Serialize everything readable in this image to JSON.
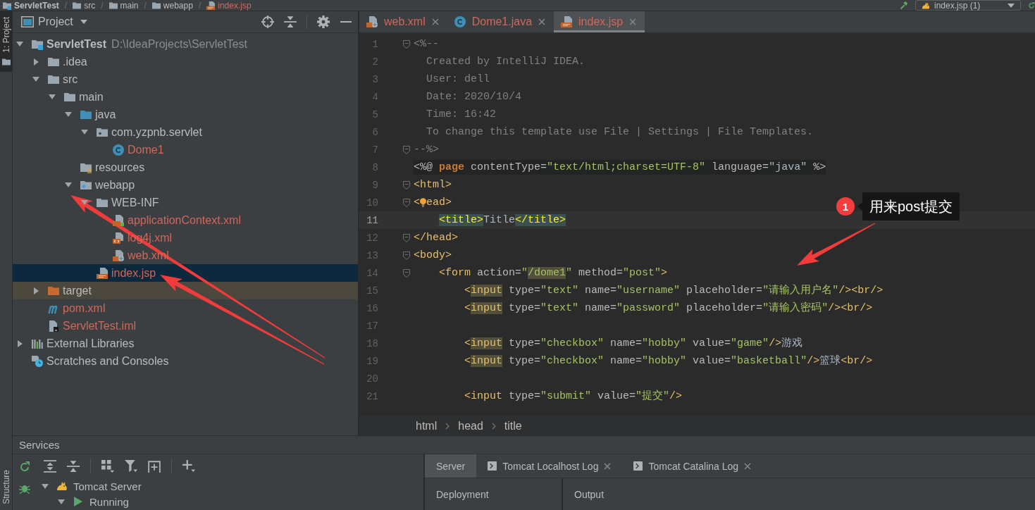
{
  "navbar": {
    "breadcrumbs": [
      {
        "kind": "module",
        "label": "ServletTest"
      },
      {
        "kind": "folder",
        "separator": "/",
        "label": "src"
      },
      {
        "kind": "folder",
        "separator": "/",
        "label": "main"
      },
      {
        "kind": "folder",
        "separator": "/",
        "label": "webapp"
      },
      {
        "kind": "jsp",
        "separator": "/",
        "label": "index.jsp"
      }
    ],
    "run_config": "index.jsp (1)"
  },
  "left_stripe": {
    "top": [
      {
        "label": "1: Project",
        "selected": true
      }
    ],
    "bottom": [
      {
        "label": "Structure",
        "selected": false
      }
    ]
  },
  "project_panel": {
    "title": "Project",
    "tree": [
      {
        "label": "ServletTest",
        "path": "D:\\IdeaProjects\\ServletTest",
        "kind": "module",
        "color": "#bbbbbb",
        "expanded": true,
        "selected": false,
        "children": [
          {
            "label": ".idea",
            "kind": "folder",
            "color": "#bbbbbb",
            "expanded": false,
            "selected": false
          },
          {
            "label": "src",
            "kind": "folder",
            "color": "#bbbbbb",
            "expanded": true,
            "selected": false,
            "children": [
              {
                "label": "main",
                "kind": "folder",
                "color": "#bbbbbb",
                "expanded": true,
                "selected": false,
                "children": [
                  {
                    "label": "java",
                    "kind": "source-folder",
                    "color": "#bbbbbb",
                    "expanded": true,
                    "selected": false,
                    "children": [
                      {
                        "label": "com.yzpnb.servlet",
                        "kind": "package",
                        "color": "#bbbbbb",
                        "expanded": true,
                        "selected": false,
                        "children": [
                          {
                            "label": "Dome1",
                            "kind": "class",
                            "color": "#d1675a",
                            "selected": false
                          }
                        ]
                      }
                    ]
                  },
                  {
                    "label": "resources",
                    "kind": "resources-folder",
                    "color": "#bbbbbb",
                    "selected": false
                  },
                  {
                    "label": "webapp",
                    "kind": "web-folder",
                    "color": "#bbbbbb",
                    "expanded": true,
                    "selected": false,
                    "children": [
                      {
                        "label": "WEB-INF",
                        "kind": "folder",
                        "color": "#bbbbbb",
                        "expanded": true,
                        "selected": false,
                        "children": [
                          {
                            "label": "applicationContext.xml",
                            "kind": "spring-xml",
                            "color": "#d1675a",
                            "selected": false
                          },
                          {
                            "label": "log4j.xml",
                            "kind": "xml",
                            "color": "#d1675a",
                            "selected": false
                          },
                          {
                            "label": "web.xml",
                            "kind": "web-xml",
                            "color": "#d1675a",
                            "selected": false
                          }
                        ]
                      },
                      {
                        "label": "index.jsp",
                        "kind": "jsp",
                        "color": "#d1675a",
                        "selected": true
                      }
                    ]
                  }
                ]
              }
            ]
          },
          {
            "label": "target",
            "kind": "excluded-folder",
            "color": "#bbbbbb",
            "expanded": false,
            "selected": false
          },
          {
            "label": "pom.xml",
            "kind": "maven",
            "color": "#d1675a",
            "selected": false
          },
          {
            "label": "ServletTest.iml",
            "kind": "iml",
            "color": "#d1675a",
            "selected": false
          }
        ]
      },
      {
        "label": "External Libraries",
        "kind": "libraries",
        "color": "#bbbbbb",
        "expanded": false,
        "selected": false
      },
      {
        "label": "Scratches and Consoles",
        "kind": "scratches",
        "color": "#bbbbbb",
        "selected": false
      }
    ]
  },
  "editor": {
    "tabs": [
      {
        "label": "web.xml",
        "kind": "web-xml",
        "selected": false
      },
      {
        "label": "Dome1.java",
        "kind": "class",
        "selected": false
      },
      {
        "label": "index.jsp",
        "kind": "jsp",
        "selected": true
      }
    ],
    "lines": [
      {
        "number": "1",
        "kind": "comment",
        "fold": true,
        "current": false,
        "tokens": [
          {
            "kind": "comment",
            "text": "<%--"
          }
        ]
      },
      {
        "number": "2",
        "kind": "comment",
        "fold": false,
        "current": false,
        "tokens": [
          {
            "kind": "comment",
            "text": "  Created by IntelliJ IDEA."
          }
        ]
      },
      {
        "number": "3",
        "kind": "comment",
        "fold": false,
        "current": false,
        "tokens": [
          {
            "kind": "comment",
            "text": "  User: dell"
          }
        ]
      },
      {
        "number": "4",
        "kind": "comment",
        "fold": false,
        "current": false,
        "tokens": [
          {
            "kind": "comment",
            "text": "  Date: 2020/10/4"
          }
        ]
      },
      {
        "number": "5",
        "kind": "comment",
        "fold": false,
        "current": false,
        "tokens": [
          {
            "kind": "comment",
            "text": "  Time: 16:42"
          }
        ]
      },
      {
        "number": "6",
        "kind": "comment",
        "fold": false,
        "current": false,
        "tokens": [
          {
            "kind": "comment",
            "text": "  To change this template use File | Settings | File Templates."
          }
        ]
      },
      {
        "number": "7",
        "kind": "comment",
        "fold": true,
        "current": false,
        "tokens": [
          {
            "kind": "comment",
            "text": "--%>"
          }
        ]
      },
      {
        "number": "8",
        "kind": "directive",
        "fold": false,
        "current": false,
        "tokens": [
          {
            "kind": "directive",
            "text": "<%@ "
          },
          {
            "kind": "keyword",
            "text": "page"
          },
          {
            "kind": "attr",
            "text": " contentType="
          },
          {
            "kind": "value",
            "text": "\"text/html;charset=UTF-8\""
          },
          {
            "kind": "attr",
            "text": " language="
          },
          {
            "kind": "text",
            "text": "\"java\""
          },
          {
            "kind": "directive",
            "text": " %>"
          }
        ]
      },
      {
        "number": "9",
        "kind": "markup",
        "fold": true,
        "current": false,
        "tokens": [
          {
            "kind": "tag",
            "text": "<html>"
          }
        ]
      },
      {
        "number": "10",
        "kind": "markup",
        "fold": true,
        "current": false,
        "tokens": [
          {
            "kind": "tag",
            "text": "<"
          },
          {
            "kind": "bulb"
          },
          {
            "kind": "tag",
            "text": "ead>"
          }
        ]
      },
      {
        "number": "11",
        "kind": "markup",
        "fold": false,
        "current": true,
        "tokens": [
          {
            "kind": "tag-match",
            "text": "    <title>"
          },
          {
            "kind": "text",
            "text": "Title"
          },
          {
            "kind": "tag-match",
            "text": "</title>"
          }
        ]
      },
      {
        "number": "12",
        "kind": "markup",
        "fold": true,
        "current": false,
        "tokens": [
          {
            "kind": "tag",
            "text": "</head>"
          }
        ]
      },
      {
        "number": "13",
        "kind": "markup",
        "fold": true,
        "current": false,
        "tokens": [
          {
            "kind": "tag",
            "text": "<body>"
          }
        ]
      },
      {
        "number": "14",
        "kind": "markup",
        "fold": true,
        "current": false,
        "tokens": [
          {
            "kind": "tag",
            "text": "    <form"
          },
          {
            "kind": "attr",
            "text": " action="
          },
          {
            "kind": "value",
            "text": "\""
          },
          {
            "kind": "value-usage",
            "text": "/dome1"
          },
          {
            "kind": "value",
            "text": "\""
          },
          {
            "kind": "attr",
            "text": " method="
          },
          {
            "kind": "value",
            "text": "\"post\""
          },
          {
            "kind": "tag",
            "text": ">"
          }
        ]
      },
      {
        "number": "15",
        "kind": "markup",
        "fold": false,
        "current": false,
        "tokens": [
          {
            "kind": "tag",
            "text": "        <"
          },
          {
            "kind": "tag-usage",
            "text": "input"
          },
          {
            "kind": "attr",
            "text": " type="
          },
          {
            "kind": "value",
            "text": "\"text\""
          },
          {
            "kind": "attr",
            "text": " name="
          },
          {
            "kind": "value",
            "text": "\"username\""
          },
          {
            "kind": "attr",
            "text": " placeholder="
          },
          {
            "kind": "value",
            "text": "\"请输入用户名\""
          },
          {
            "kind": "tag",
            "text": "/><br/>"
          }
        ]
      },
      {
        "number": "16",
        "kind": "markup",
        "fold": false,
        "current": false,
        "tokens": [
          {
            "kind": "tag",
            "text": "        <"
          },
          {
            "kind": "tag-usage",
            "text": "input"
          },
          {
            "kind": "attr",
            "text": " type="
          },
          {
            "kind": "value",
            "text": "\"text\""
          },
          {
            "kind": "attr",
            "text": " name="
          },
          {
            "kind": "value",
            "text": "\"password\""
          },
          {
            "kind": "attr",
            "text": " placeholder="
          },
          {
            "kind": "value",
            "text": "\"请输入密码\""
          },
          {
            "kind": "tag",
            "text": "/><br/>"
          }
        ]
      },
      {
        "number": "17",
        "fold": false,
        "current": false
      },
      {
        "number": "18",
        "kind": "markup",
        "fold": false,
        "current": false,
        "tokens": [
          {
            "kind": "tag",
            "text": "        <"
          },
          {
            "kind": "tag-usage",
            "text": "input"
          },
          {
            "kind": "attr",
            "text": " type="
          },
          {
            "kind": "value",
            "text": "\"checkbox\""
          },
          {
            "kind": "attr",
            "text": " name="
          },
          {
            "kind": "value",
            "text": "\"hobby\""
          },
          {
            "kind": "attr",
            "text": " value="
          },
          {
            "kind": "value",
            "text": "\"game\""
          },
          {
            "kind": "tag",
            "text": "/>"
          },
          {
            "kind": "text",
            "text": "游戏"
          }
        ]
      },
      {
        "number": "19",
        "kind": "markup",
        "fold": false,
        "current": false,
        "tokens": [
          {
            "kind": "tag",
            "text": "        <"
          },
          {
            "kind": "tag-usage",
            "text": "input"
          },
          {
            "kind": "attr",
            "text": " type="
          },
          {
            "kind": "value",
            "text": "\"checkbox\""
          },
          {
            "kind": "attr",
            "text": " name="
          },
          {
            "kind": "value",
            "text": "\"hobby\""
          },
          {
            "kind": "attr",
            "text": " value="
          },
          {
            "kind": "value",
            "text": "\"basketball\""
          },
          {
            "kind": "tag",
            "text": "/>"
          },
          {
            "kind": "text",
            "text": "篮球"
          },
          {
            "kind": "tag",
            "text": "<br/>"
          }
        ]
      },
      {
        "number": "20",
        "fold": false,
        "current": false
      },
      {
        "number": "21",
        "kind": "markup",
        "fold": false,
        "current": false,
        "tokens": [
          {
            "kind": "tag",
            "text": "        <input"
          },
          {
            "kind": "attr",
            "text": " type="
          },
          {
            "kind": "value",
            "text": "\"submit\""
          },
          {
            "kind": "attr",
            "text": " value="
          },
          {
            "kind": "value",
            "text": "\"提交\""
          },
          {
            "kind": "tag",
            "text": "/>"
          }
        ]
      }
    ],
    "breadcrumbs": [
      "html",
      "head",
      "title"
    ]
  },
  "services": {
    "title": "Services",
    "tree": [
      {
        "label": "Tomcat Server",
        "kind": "server",
        "expanded": true,
        "selected": false,
        "children": [
          {
            "label": "Running",
            "kind": "running",
            "expanded": true,
            "selected": false
          }
        ]
      }
    ],
    "tabs": [
      {
        "label": "Server",
        "kind": "plain",
        "selected": true
      },
      {
        "label": "Tomcat Localhost Log",
        "kind": "log",
        "selected": false
      },
      {
        "label": "Tomcat Catalina Log",
        "kind": "log",
        "selected": false
      }
    ],
    "panes": [
      "Deployment",
      "Output"
    ]
  },
  "annotation": {
    "badge": "1",
    "text": "用来post提交"
  }
}
